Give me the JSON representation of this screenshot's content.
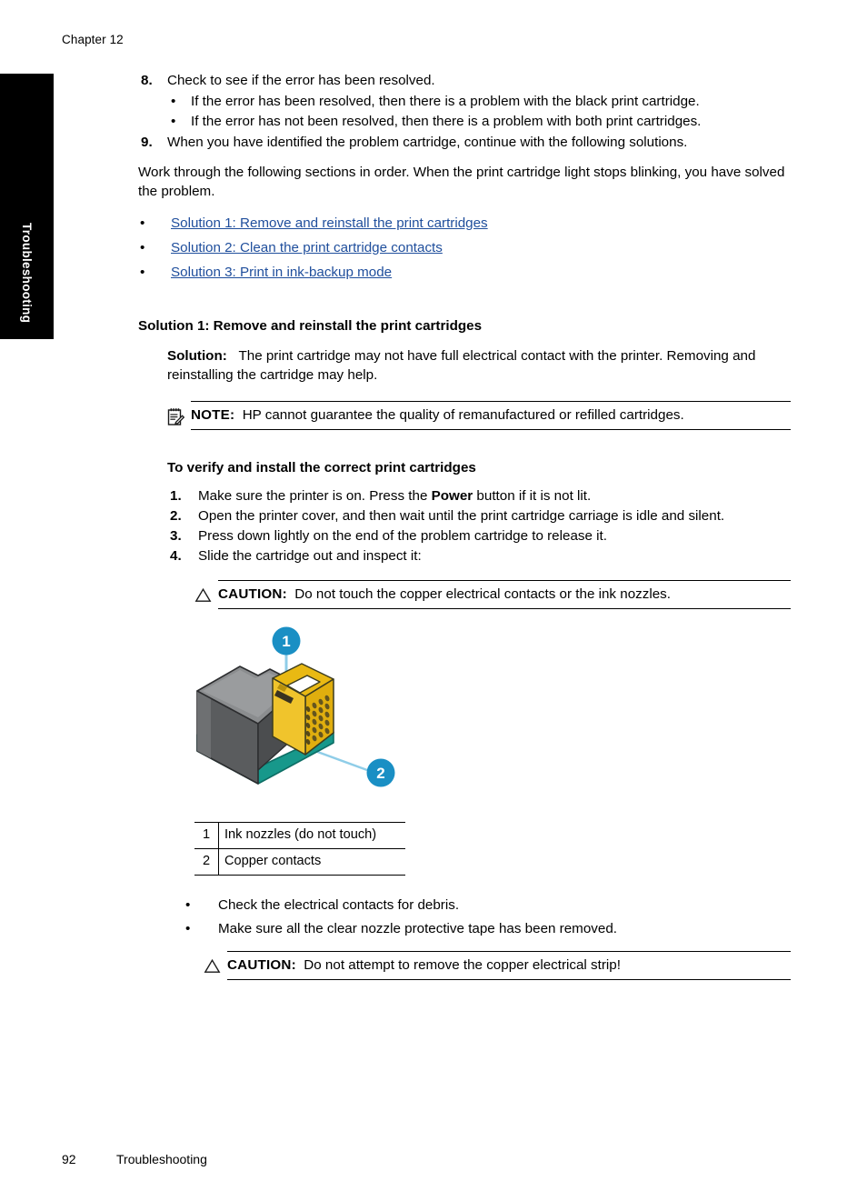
{
  "header": {
    "chapter": "Chapter 12"
  },
  "side_tab": {
    "label": "Troubleshooting"
  },
  "steps_top": [
    {
      "number": "8.",
      "text": "Check to see if the error has been resolved.",
      "substeps": [
        "If the error has been resolved, then there is a problem with the black print cartridge.",
        "If the error has not been resolved, then there is a problem with both print cartridges."
      ]
    },
    {
      "number": "9.",
      "text": "When you have identified the problem cartridge, continue with the following solutions.",
      "substeps": []
    }
  ],
  "intro_paragraph": "Work through the following sections in order. When the print cartridge light stops blinking, you have solved the problem.",
  "solution_links": [
    "Solution 1: Remove and reinstall the print cartridges",
    "Solution 2: Clean the print cartridge contacts",
    "Solution 3: Print in ink-backup mode"
  ],
  "solution_heading": "Solution 1: Remove and reinstall the print cartridges",
  "solution": {
    "label": "Solution:",
    "text": "The print cartridge may not have full electrical contact with the printer. Removing and reinstalling the cartridge may help."
  },
  "note": {
    "label": "NOTE:",
    "text": "HP cannot guarantee the quality of remanufactured or refilled cartridges.",
    "icon": "note-pencil-icon"
  },
  "procedure_heading": "To verify and install the correct print cartridges",
  "procedure_steps": [
    {
      "number": "1.",
      "pre": "Make sure the printer is on. Press the ",
      "bold": "Power",
      "post": " button if it is not lit."
    },
    {
      "number": "2.",
      "pre": "Open the printer cover, and then wait until the print cartridge carriage is idle and silent.",
      "bold": "",
      "post": ""
    },
    {
      "number": "3.",
      "pre": "Press down lightly on the end of the problem cartridge to release it.",
      "bold": "",
      "post": ""
    },
    {
      "number": "4.",
      "pre": "Slide the cartridge out and inspect it:",
      "bold": "",
      "post": ""
    }
  ],
  "caution_1": {
    "label": "CAUTION:",
    "text": "Do not touch the copper electrical contacts or the ink nozzles.",
    "icon": "caution-triangle-icon"
  },
  "figure": {
    "name": "print-cartridge-illustration",
    "callouts": [
      {
        "number": "1",
        "target": "ink-nozzles"
      },
      {
        "number": "2",
        "target": "copper-contacts"
      }
    ],
    "colors": {
      "callout_circle": "#1a8fc4",
      "leader_line": "#7fc6e4",
      "body_dark": "#545557",
      "body_light": "#8d8f91",
      "base_teal": "#1f9e8f",
      "front_yellow": "#e8b511",
      "contacts_dark": "#6b5a1e"
    }
  },
  "legend_table": {
    "rows": [
      {
        "num": "1",
        "desc": "Ink nozzles (do not touch)"
      },
      {
        "num": "2",
        "desc": "Copper contacts"
      }
    ]
  },
  "post_bullets": [
    "Check the electrical contacts for debris.",
    "Make sure all the clear nozzle protective tape has been removed."
  ],
  "caution_2": {
    "label": "CAUTION:",
    "text": "Do not attempt to remove the copper electrical strip!",
    "icon": "caution-triangle-icon"
  },
  "footer": {
    "page_number": "92",
    "section": "Troubleshooting"
  },
  "colors": {
    "link": "#1f4e9c",
    "tab_background": "#000000",
    "text": "#000000"
  }
}
